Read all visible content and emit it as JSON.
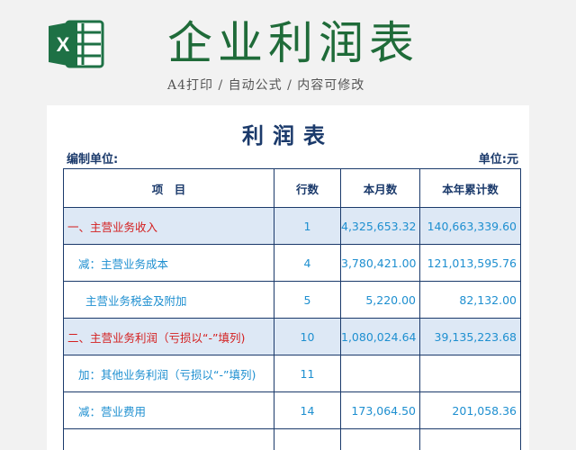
{
  "header": {
    "title": "企业利润表",
    "subtitle": "A4打印 / 自动公式 / 内容可修改",
    "logo_icon": "excel-logo-icon",
    "colors": {
      "title": "#1f6b39",
      "excel_green": "#1e7145"
    }
  },
  "sheet": {
    "title": "利润表",
    "unit_left": "编制单位:",
    "unit_right": "单位:元",
    "columns": [
      "项　目",
      "行数",
      "本月数",
      "本年累计数"
    ],
    "rows": [
      {
        "item": "一、主营业务收入",
        "row": "1",
        "month": "4,325,653.32",
        "year": "140,663,339.60"
      },
      {
        "item": "减：主营业务成本",
        "row": "4",
        "month": "3,780,421.00",
        "year": "121,013,595.76"
      },
      {
        "item": "主营业务税金及附加",
        "row": "5",
        "month": "5,220.00",
        "year": "82,132.00"
      },
      {
        "item": "二、主营业务利润（亏损以“-”填列)",
        "row": "10",
        "month": "1,080,024.64",
        "year": "39,135,223.68"
      },
      {
        "item": "加：其他业务利润（亏损以“-”填列)",
        "row": "11",
        "month": "",
        "year": ""
      },
      {
        "item": "减：营业费用",
        "row": "14",
        "month": "173,064.50",
        "year": "201,058.36"
      }
    ],
    "colors": {
      "header_text": "#1b3a6b",
      "value_text": "#1e8fd0",
      "section_text": "#d42020",
      "highlight_bg": "#dde8f5"
    }
  }
}
